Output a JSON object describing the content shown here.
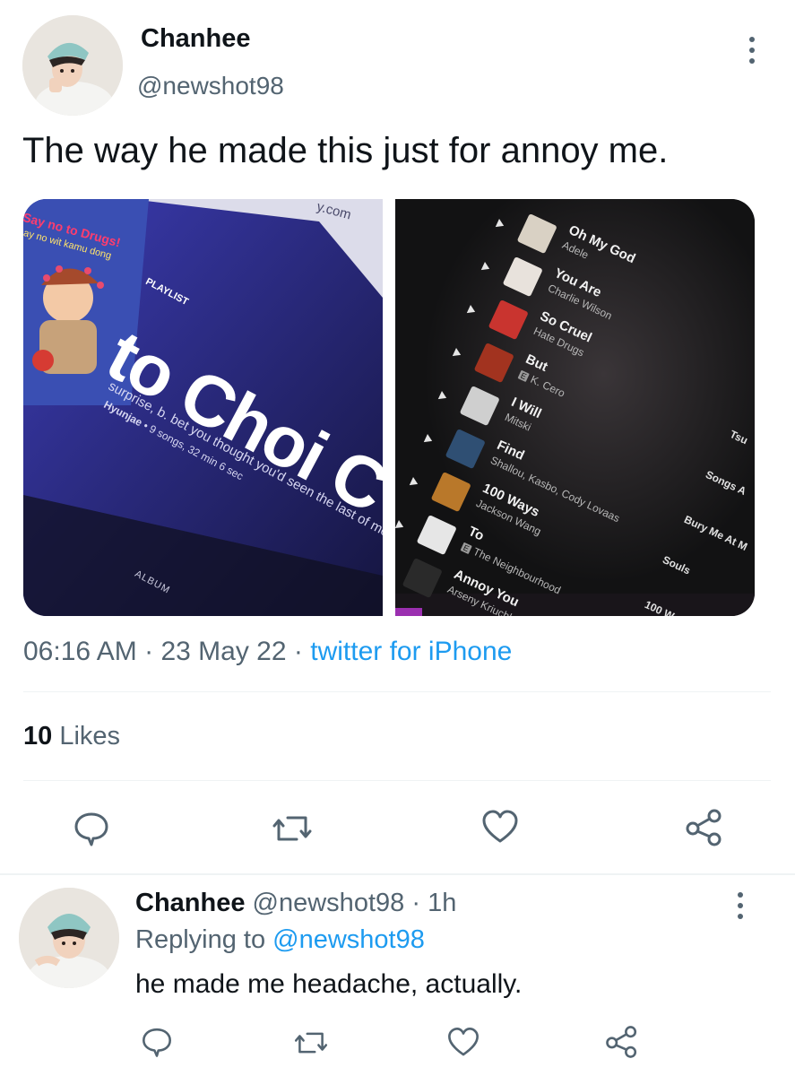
{
  "main_tweet": {
    "display_name": "Chanhee",
    "handle": "@newshot98",
    "text": "The way he made this just for annoy me.",
    "time": "06:16 AM",
    "date": "23 May 22",
    "separator": "·",
    "source": "twitter for iPhone",
    "likes_count": "10",
    "likes_label": "Likes"
  },
  "media_left": {
    "url_fragment": "y.com",
    "sticker_line1": "Say no to Drugs!",
    "sticker_line2": "ay no wit kamu dong",
    "label": "PLAYLIST",
    "title": "to Choi C",
    "description": "surprise, b. bet you thought you'd seen the last of me",
    "meta_owner": "Hyunjae",
    "meta_rest": " • 9 songs, 32 min 6 sec",
    "album_label": "ALBUM"
  },
  "media_right": {
    "tracks": [
      {
        "title": "Oh My God",
        "artist": "Adele",
        "color": "#d9d1c4"
      },
      {
        "title": "You Are",
        "artist": "Charlie Wilson",
        "color": "#e8e2dc"
      },
      {
        "title": "So Cruel",
        "artist": "Hate Drugs",
        "color": "#c9342f"
      },
      {
        "title": "But",
        "artist": "K. Cero",
        "color": "#a2331f"
      },
      {
        "title": "I Will",
        "artist": "Mitski",
        "color": "#cfcfcf"
      },
      {
        "title": "Find",
        "artist": "Shallou, Kasbo, Cody Lovaas",
        "color": "#2f4f73"
      },
      {
        "title": "100 Ways",
        "artist": "Jackson Wang",
        "color": "#b9782a"
      },
      {
        "title": "To",
        "artist": "The Neighbourhood",
        "color": "#e6e6e6"
      },
      {
        "title": "Annoy You",
        "artist": "Arseny Kriuchl",
        "color": "#2a2a2a"
      }
    ],
    "side_list": [
      "Tsu",
      "Songs A",
      "Bury Me At M",
      "Souls",
      "100 W"
    ],
    "explicit_badge": "E"
  },
  "reply": {
    "display_name": "Chanhee",
    "handle": "@newshot98",
    "separator": "·",
    "age": "1h",
    "replying_prefix": "Replying to",
    "replying_to": "@newshot98",
    "text": "he made me headache, actually."
  },
  "icons": [
    "reply-icon",
    "retweet-icon",
    "like-icon",
    "share-icon",
    "more-icon"
  ],
  "colors": {
    "link": "#1d9bf0",
    "muted": "#536471",
    "text": "#0f1419",
    "divider": "#eff3f4"
  }
}
